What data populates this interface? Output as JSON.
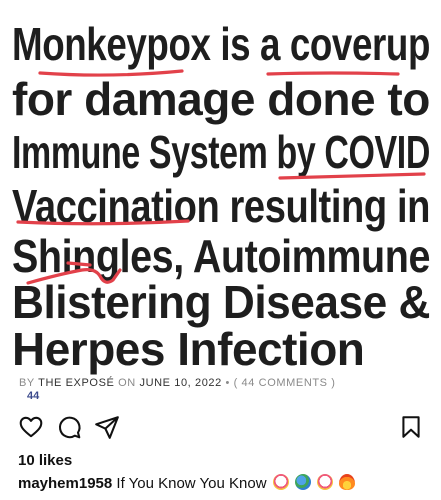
{
  "post": {
    "headline_lines": [
      "Monkeypox is a coverup",
      "for damage done to",
      "Immune System by COVID",
      "Vaccination resulting in",
      "Shingles, Autoimmune",
      "Blistering Disease &",
      "Herpes Infection"
    ],
    "byline": {
      "by": "BY",
      "author": "THE EXPOSÉ",
      "on": "ON",
      "date": "JUNE 10, 2022",
      "separator": "•",
      "comments": "( 44 COMMENTS )",
      "count": "44"
    }
  },
  "actions": {
    "like": "heart-icon",
    "comment": "comment-icon",
    "share": "send-icon",
    "save": "bookmark-icon"
  },
  "likes": "10 likes",
  "caption": {
    "username": "mayhem1958",
    "text": "If You Know You Know",
    "emojis": [
      "clown-face",
      "globe",
      "clown-face",
      "fire"
    ]
  },
  "colors": {
    "headline": "#1e1e1e",
    "underline": "#e2414a",
    "byline": "#8a8a8a",
    "count": "#3b4a8c"
  }
}
